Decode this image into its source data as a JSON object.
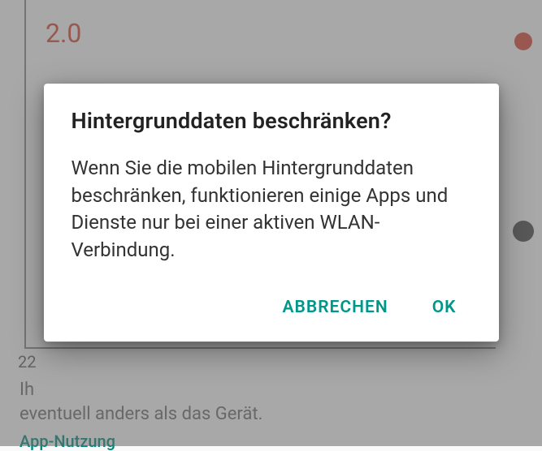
{
  "background": {
    "chartValue": "2.0",
    "axisLabel": "22",
    "captionLine1": "Ih",
    "captionLine2": "eventuell anders als das Gerät.",
    "sectionHeading": "App-Nutzung"
  },
  "dialog": {
    "title": "Hintergrunddaten beschränken?",
    "body": "Wenn Sie die mobilen Hintergrunddaten beschränken, funktionieren einige Apps und Dienste nur bei einer aktiven WLAN-Verbindung.",
    "cancelLabel": "ABBRECHEN",
    "okLabel": "OK"
  }
}
